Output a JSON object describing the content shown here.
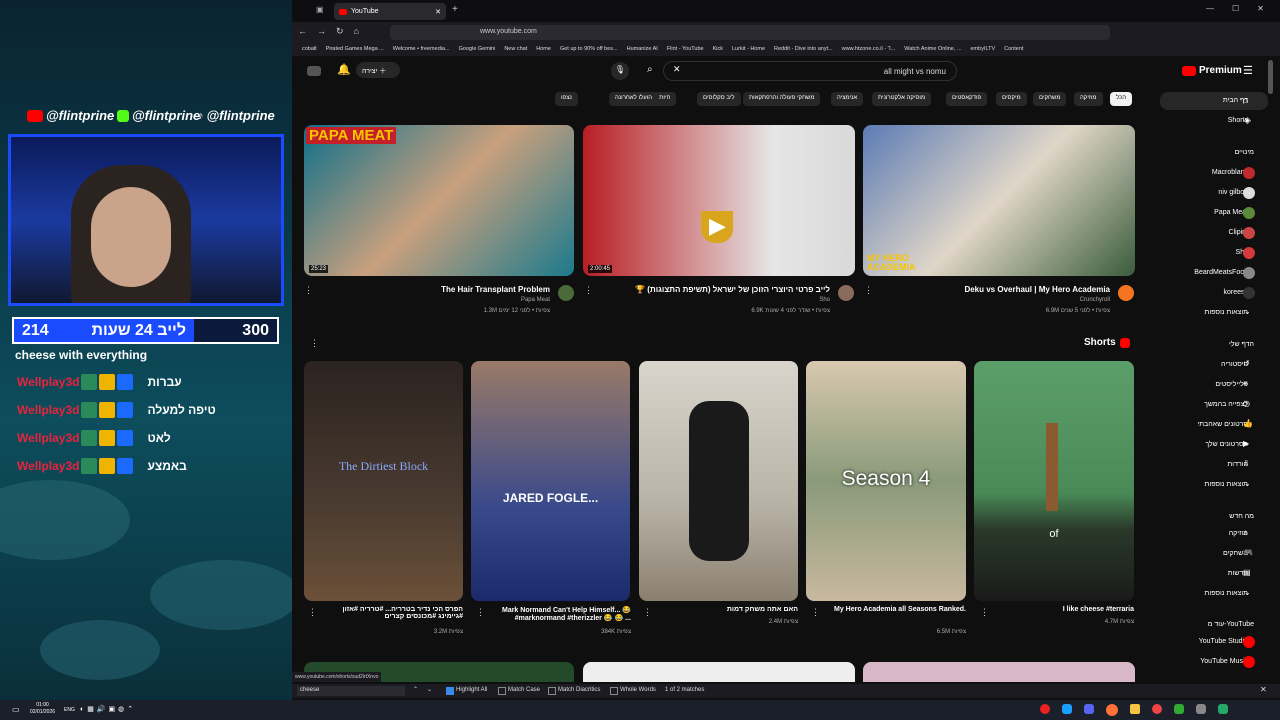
{
  "overlay": {
    "social": [
      "@flintprine",
      "@flintprine",
      "@flintprine"
    ],
    "sub_left_num": "214",
    "sub_left_label": "לייב 24 שעות",
    "sub_right_num": "300",
    "tagline": "cheese with everything",
    "chat": [
      {
        "user": "Wellplay3d",
        "msg": "עברות"
      },
      {
        "user": "Wellplay3d",
        "msg": "טיפה למעלה"
      },
      {
        "user": "Wellplay3d",
        "msg": "לאט"
      },
      {
        "user": "Wellplay3d",
        "msg": "באמצע"
      }
    ]
  },
  "browser": {
    "tab_title": "YouTube",
    "url": "www.youtube.com",
    "bookmarks": [
      "cobalt",
      "Pirated Games Mega ...",
      "Welcome • freemedia...",
      "Google Gemini",
      "New chat",
      "Home",
      "Get up to 90% off bes...",
      "Humanize AI",
      "Flint - YouTube",
      "Kick",
      "Lurkit - Home",
      "Reddit - Dive into anyt...",
      "www.htzone.co.il - ד...",
      "Watch Anime Online, ...",
      "embyILTV",
      "Content"
    ]
  },
  "youtube": {
    "search_value": "all might vs nomu",
    "premium_label": "Premium",
    "create_label": "יצירה",
    "chips": [
      "הכל",
      "מוזיקה",
      "משחקים",
      "מיקסים",
      "פודקאסטים",
      "מוסיקה אלקטרונית",
      "אנימציה",
      "משחקי פעולה והרפתקאות",
      "ליב סקלוסים",
      "חיות מחמד",
      "הועלו לאחרונה",
      "נצפו",
      "חדש בשבילך"
    ],
    "videos": [
      {
        "title": "The Hair Transplant Problem",
        "channel": "Papa Meat",
        "meta": "1.3M צפיות • לפני 12 ימים",
        "duration": "25:23",
        "thumb_text": "PAPA MEAT"
      },
      {
        "title": "🏆 לייב פרטי היוצרי הזוכן של ישראל (תשיפת התצוגות)",
        "channel": "Sho",
        "meta": "6.9K צפיות • שודר לפני 4 שעות",
        "duration": "2:00:45",
        "thumb_text": ""
      },
      {
        "title": "Deku vs Overhaul | My Hero Academia",
        "channel": "Crunchyroll",
        "meta": "6.9M צפיות • לפני 5 שנים",
        "duration": "",
        "thumb_text": "MY HERO ACADEMIA"
      }
    ],
    "shorts_label": "Shorts",
    "shorts": [
      {
        "title": "הפרס הכי נדיר בטרריה... #טרריה #אזון #גיימינג #מכונסים קצרים",
        "meta": "3.2M צפיות",
        "overlay": "The Dirtiest Block"
      },
      {
        "title": "Mark Normand Can't Help Himself... 😂 #marknormand #therizzler 😂 😂 ...",
        "meta": "384K צפיות",
        "overlay": "JARED FOGLE..."
      },
      {
        "title": "האם אתה משחק דמות",
        "meta": "2.4M צפיות",
        "overlay": ""
      },
      {
        "title": "My Hero Academia all Seasons Ranked.",
        "meta": "6.5M צפיות",
        "overlay": "Season 4"
      },
      {
        "title": "I like cheese #terraria",
        "meta": "4.7M צפיות",
        "overlay": "of"
      }
    ],
    "sidebar": {
      "top": [
        "דף הבית",
        "Shorts"
      ],
      "subs_header": "מינויים",
      "subs": [
        "Macroblank",
        "niv gilboa",
        "Papa Meat",
        "Clipim",
        "Sho",
        "BeardMeatsFood",
        "koreess",
        "תוצאות נוספות"
      ],
      "you_header": "הדף שלי",
      "you": [
        "היסטוריה",
        "פלייליסטים",
        "לצפייה בהמשך",
        "סרטונים שאהבתי",
        "הסרטונים שלך",
        "הורדות",
        "תוצאות נוספות"
      ],
      "explore_header": "מה חדש",
      "explore": [
        "מוזיקה",
        "משחקים",
        "חדשות",
        "תוצאות נוספות"
      ],
      "more_header": "עוד מ-YouTube",
      "more": [
        "YouTube Studio",
        "YouTube Music"
      ]
    }
  },
  "findbar": {
    "query": "cheese",
    "highlight_all": "Highlight All",
    "match_case": "Match Case",
    "match_diacritics": "Match Diacritics",
    "whole_words": "Whole Words",
    "result": "1 of 2 matches",
    "status_url": "www.youtube.com/shorts/sud2lrtXnvo"
  },
  "taskbar": {
    "time": "01:00",
    "date": "02/01/2026",
    "lang": "ENG"
  },
  "colors": {
    "yt_red": "#ff0000",
    "webcam_border": "#1a4bff",
    "chat_user": "#e8233b"
  }
}
